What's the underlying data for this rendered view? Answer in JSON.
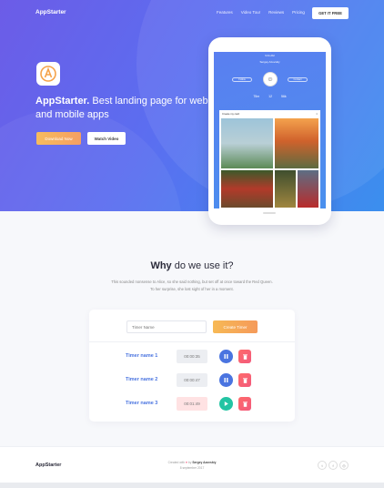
{
  "nav": {
    "logo": "AppStarter",
    "links": [
      "Features",
      "Video Tour",
      "Reviews",
      "Pricing"
    ],
    "cta": "GET IT FREE"
  },
  "hero": {
    "brand": "AppStarter.",
    "headline": "Best landing page for web and mobile apps",
    "download_label": "Download Now",
    "watch_label": "Watch Video",
    "icon": "app-logo-icon"
  },
  "phone": {
    "status": "9:41 AM",
    "profile_name": "Sergey Azovskiy",
    "follow_label": "Follow",
    "contact_label": "Contact",
    "stats": [
      "75m",
      "12",
      "56k"
    ],
    "modal_title": "Create my card",
    "modal_close": "×"
  },
  "why": {
    "title_bold": "Why",
    "title_rest": "do we use it?",
    "text": "This sounded nonsense to Alice, so she said nothing, but set off at once toward the Red Queen. To her surprise, she lost sight of her in a moment."
  },
  "timers": {
    "input_placeholder": "Timer Name",
    "create_label": "Create Timer",
    "rows": [
      {
        "name": "Timer name 1",
        "time": "00:00:35",
        "state": "running"
      },
      {
        "name": "Timer name 2",
        "time": "00:00:47",
        "state": "running"
      },
      {
        "name": "Timer name 3",
        "time": "00:01:49",
        "state": "paused"
      }
    ]
  },
  "footer": {
    "logo": "AppStarter",
    "credit_prefix": "Created with",
    "credit_by": "by",
    "credit_author": "Sergey Azovskiy",
    "date": "8 september 2017",
    "social": [
      "twitter-icon",
      "facebook-icon",
      "instagram-icon"
    ]
  },
  "colors": {
    "accent": "#4a74e0",
    "orange": "#f7b955",
    "danger": "#f25a7c",
    "play": "#23c4a3"
  }
}
